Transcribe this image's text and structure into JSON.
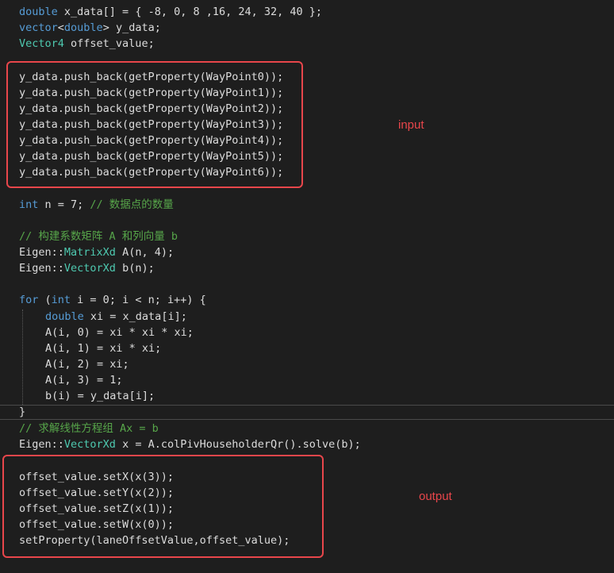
{
  "code": {
    "line1": {
      "kw": "double",
      "rest": " x_data[] = { -8, 0, 8 ,16, 24, 32, 40 };"
    },
    "line2": {
      "kw": "vector",
      "lt": "<",
      "kw2": "double",
      "gt": ">",
      "rest": " y_data;"
    },
    "line3": {
      "ty": "Vector4",
      "rest": " offset_value;"
    },
    "input_lines": [
      "y_data.push_back(getProperty(WayPoint0));",
      "y_data.push_back(getProperty(WayPoint1));",
      "y_data.push_back(getProperty(WayPoint2));",
      "y_data.push_back(getProperty(WayPoint3));",
      "y_data.push_back(getProperty(WayPoint4));",
      "y_data.push_back(getProperty(WayPoint5));",
      "y_data.push_back(getProperty(WayPoint6));"
    ],
    "int_line": {
      "kw": "int",
      "rest": " n = 7; ",
      "comment": "// 数据点的数量"
    },
    "comment_build": "// 构建系数矩阵 A 和列向量 b",
    "matrix_line": {
      "ns": "Eigen::",
      "ty": "MatrixXd",
      "rest": " A(n, 4);"
    },
    "vector_line": {
      "ns": "Eigen::",
      "ty": "VectorXd",
      "rest": " b(n);"
    },
    "for_line": {
      "kw": "for",
      "p1": " (",
      "kw2": "int",
      "rest": " i = 0; i < n; i++) {"
    },
    "loop_double": {
      "kw": "double",
      "rest": " xi = x_data[i];"
    },
    "loop_body": [
      "A(i, 0) = xi * xi * xi;",
      "A(i, 1) = xi * xi;",
      "A(i, 2) = xi;",
      "A(i, 3) = 1;",
      "b(i) = y_data[i];"
    ],
    "close_brace": "}",
    "comment_solve": "// 求解线性方程组 Ax = b",
    "solve_line": {
      "ns": "Eigen::",
      "ty": "VectorXd",
      "rest": " x = A.colPivHouseholderQr().solve(b);"
    },
    "output_lines": [
      "offset_value.setX(x(3));",
      "offset_value.setY(x(2));",
      "offset_value.setZ(x(1));",
      "offset_value.setW(x(0));",
      "setProperty(laneOffsetValue,offset_value);"
    ]
  },
  "annotations": {
    "input_label": "input",
    "output_label": "output",
    "accent_color": "#e8464b"
  }
}
